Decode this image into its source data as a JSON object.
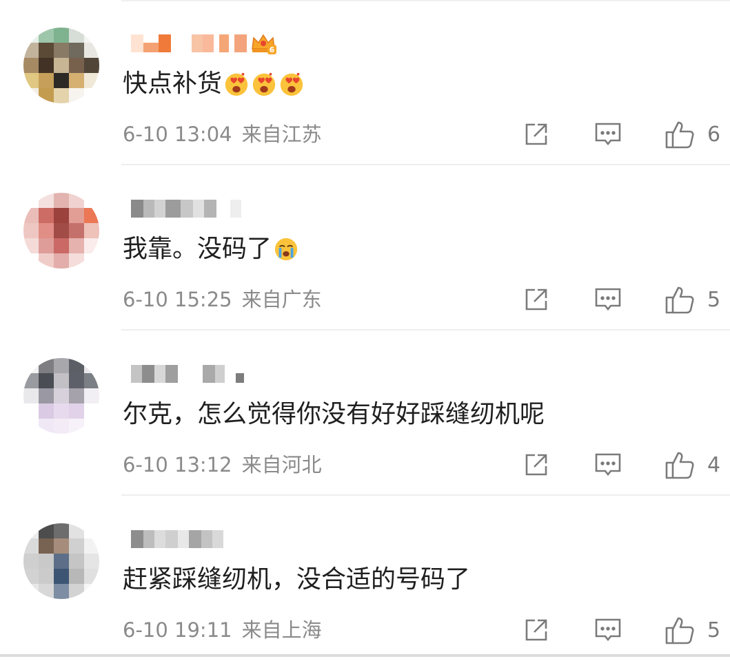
{
  "comments": [
    {
      "text": "快点补货",
      "emojis": [
        "heart-eyes-emoji",
        "heart-eyes-emoji",
        "heart-eyes-emoji"
      ],
      "time": "6-10 13:04",
      "location": "来自江苏",
      "likes": "6",
      "username_badge": "crown-level-6-icon"
    },
    {
      "text": "我靠。没码了",
      "emojis": [
        "crying-emoji"
      ],
      "time": "6-10 15:25",
      "location": "来自广东",
      "likes": "5"
    },
    {
      "text": "尔克，怎么觉得你没有好好踩缝纫机呢",
      "emojis": [],
      "time": "6-10 13:12",
      "location": "来自河北",
      "likes": "4"
    },
    {
      "text": "赶紧踩缝纫机，没合适的号码了",
      "emojis": [],
      "time": "6-10 19:11",
      "location": "来自上海",
      "likes": "5"
    }
  ],
  "icons": {
    "share": "share-icon",
    "reply": "comment-icon",
    "like": "thumbs-up-icon"
  },
  "colors": {
    "meta_text": "#8a8a8a",
    "icon_stroke": "#7a7a7a",
    "divider": "#eeeeee"
  }
}
